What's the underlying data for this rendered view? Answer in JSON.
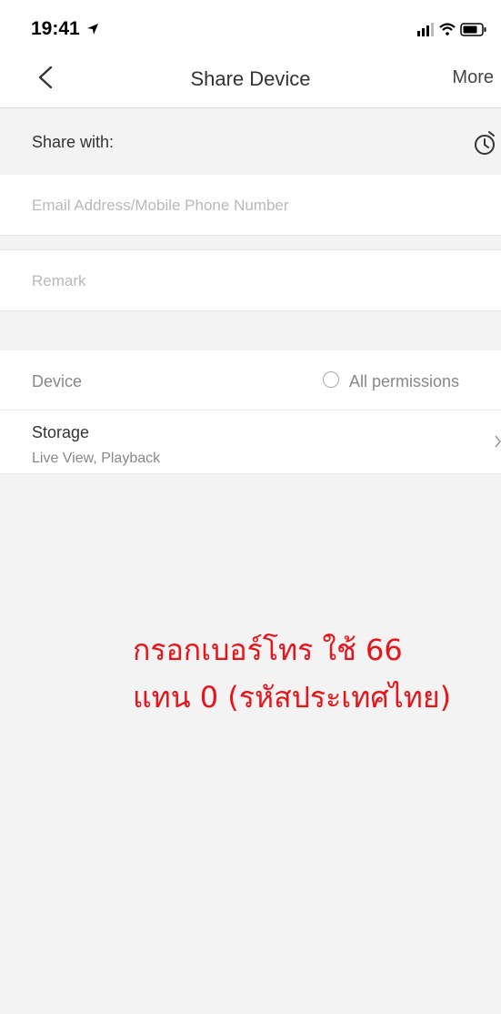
{
  "status_bar": {
    "time": "19:41"
  },
  "nav": {
    "title": "Share Device",
    "more_label": "More"
  },
  "share": {
    "label": "Share with:"
  },
  "email": {
    "placeholder": "Email Address/Mobile Phone Number"
  },
  "remark": {
    "placeholder": "Remark"
  },
  "device": {
    "label": "Device",
    "all_permissions_label": "All permissions",
    "all_permissions_checked": false
  },
  "storage": {
    "title": "Storage",
    "subtitle": "Live View, Playback"
  },
  "annotation": {
    "line1": "กรอกเบอร์โทร ใช้ 66",
    "line2": "แทน 0 (รหัสประเทศไทย)",
    "color": "#e8141a"
  },
  "colors": {
    "background": "#f3f3f3",
    "surface": "#ffffff",
    "placeholder": "#b9b9b9",
    "annotation": "#e8141a"
  }
}
